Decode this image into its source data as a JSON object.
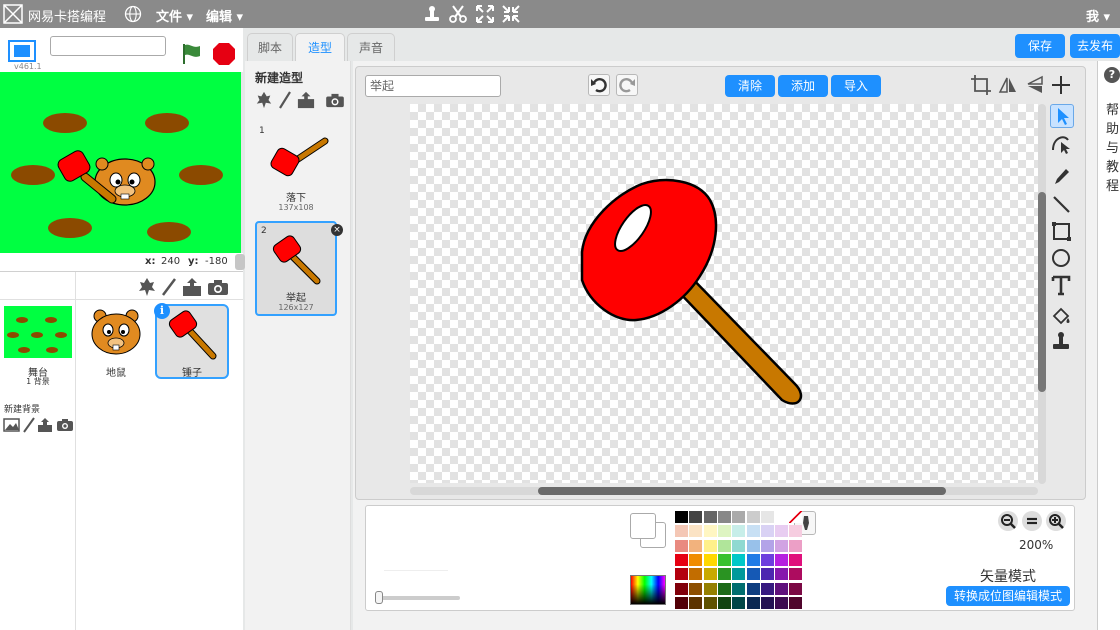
{
  "topbar": {
    "brand": "网易卡搭编程",
    "menu_file": "文件 ▾",
    "menu_edit": "编辑 ▾",
    "user": "我 ▾"
  },
  "stage": {
    "version": "v461.1",
    "coords": {
      "x_label": "x:",
      "x_value": "240",
      "y_label": "y:",
      "y_value": "-180"
    }
  },
  "sprites": {
    "stage_tile": {
      "name": "舞台",
      "sub": "1 背景"
    },
    "items": [
      {
        "name": "地鼠"
      },
      {
        "name": "锤子"
      }
    ],
    "new_backdrop_label": "新建背景"
  },
  "tabs": [
    {
      "label": "脚本"
    },
    {
      "label": "造型"
    },
    {
      "label": "声音"
    }
  ],
  "header_buttons": {
    "save": "保存",
    "publish": "去发布"
  },
  "costumes": {
    "title": "新建造型",
    "items": [
      {
        "num": "1",
        "name": "落下",
        "size": "137x108"
      },
      {
        "num": "2",
        "name": "举起",
        "size": "126x127"
      }
    ]
  },
  "editor": {
    "costume_name_value": "举起",
    "btn_clear": "清除",
    "btn_add": "添加",
    "btn_import": "导入",
    "zoom": "200%",
    "mode": "矢量模式",
    "convert": "转换成位图编辑模式"
  },
  "palette": {
    "rows": [
      [
        "#000000",
        "#444444",
        "#666666",
        "#888888",
        "#aaaaaa",
        "#cccccc",
        "#e6e6e6",
        "#ffffff",
        "none"
      ],
      [
        "#f4c7b5",
        "#fbe3c4",
        "#fff6c2",
        "#def4c2",
        "#c7eee9",
        "#c8e0f4",
        "#d9d2f4",
        "#e8cdf1",
        "#f6cde0"
      ],
      [
        "#e98a80",
        "#f2b27d",
        "#fff08a",
        "#b0e59a",
        "#8fd9d1",
        "#98c1ea",
        "#b3a3e8",
        "#d1a3e3",
        "#ec9fc6"
      ],
      [
        "#e60012",
        "#f08c00",
        "#ffd800",
        "#37c12e",
        "#00c8c8",
        "#1f7be6",
        "#6d3fde",
        "#b620e0",
        "#e00f7c"
      ],
      [
        "#b3000e",
        "#c26d00",
        "#c9a900",
        "#2a9322",
        "#00999b",
        "#1559b5",
        "#4d25b0",
        "#8617ad",
        "#ad0c5f"
      ],
      [
        "#80000a",
        "#8d4f00",
        "#958000",
        "#1d6a18",
        "#006e6f",
        "#0f3e80",
        "#361a80",
        "#5f107c",
        "#7b0944"
      ],
      [
        "#520006",
        "#5c3300",
        "#5f5200",
        "#124410",
        "#004748",
        "#0a2852",
        "#231152",
        "#3d0a50",
        "#50052c"
      ]
    ]
  },
  "help": {
    "text": "帮助与教程"
  },
  "colors": {
    "accent": "#1e90ff",
    "stage_bg": "#00ff41",
    "hammer_head": "#ff0000",
    "hammer_handle": "#c87800"
  }
}
